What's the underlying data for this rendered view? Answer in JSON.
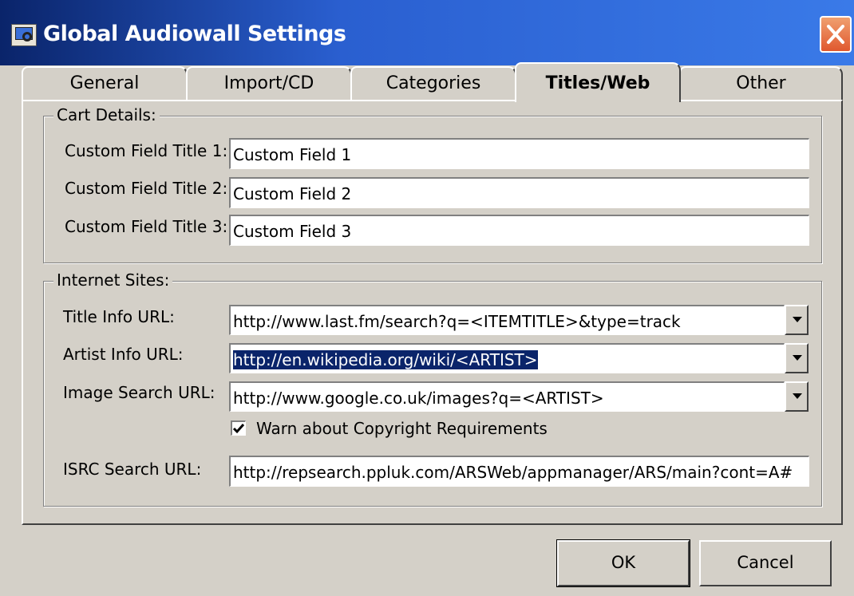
{
  "window": {
    "title": "Global Audiowall Settings"
  },
  "tabs": [
    {
      "label": "General"
    },
    {
      "label": "Import/CD"
    },
    {
      "label": "Categories"
    },
    {
      "label": "Titles/Web",
      "active": true
    },
    {
      "label": "Other"
    }
  ],
  "cart_details": {
    "group_label": "Cart Details:",
    "fields": [
      {
        "label": "Custom Field Title 1:",
        "value": "Custom Field 1"
      },
      {
        "label": "Custom Field Title 2:",
        "value": "Custom Field 2"
      },
      {
        "label": "Custom Field Title 3:",
        "value": "Custom Field 3"
      }
    ]
  },
  "internet_sites": {
    "group_label": "Internet Sites:",
    "title_info": {
      "label": "Title Info URL:",
      "value": "http://www.last.fm/search?q=<ITEMTITLE>&type=track"
    },
    "artist_info": {
      "label": "Artist Info URL:",
      "value": "http://en.wikipedia.org/wiki/<ARTIST>"
    },
    "image_search": {
      "label": "Image Search URL:",
      "value": "http://www.google.co.uk/images?q=<ARTIST>"
    },
    "warn_copyright": {
      "label": "Warn about Copyright Requirements",
      "checked": true
    },
    "isrc_search": {
      "label": "ISRC Search URL:",
      "value": "http://repsearch.ppluk.com/ARSWeb/appmanager/ARS/main?cont=A#"
    }
  },
  "buttons": {
    "ok": "OK",
    "cancel": "Cancel"
  },
  "icons": {
    "app": "magnifier-monitor-icon",
    "close": "close-icon",
    "dropdown": "chevron-down-icon",
    "check": "check-icon"
  },
  "colors": {
    "titlebar_start": "#0a246a",
    "titlebar_end": "#3a7ae8",
    "close_button": "#e0582e",
    "selection": "#0a246a",
    "face": "#d4d0c8"
  }
}
